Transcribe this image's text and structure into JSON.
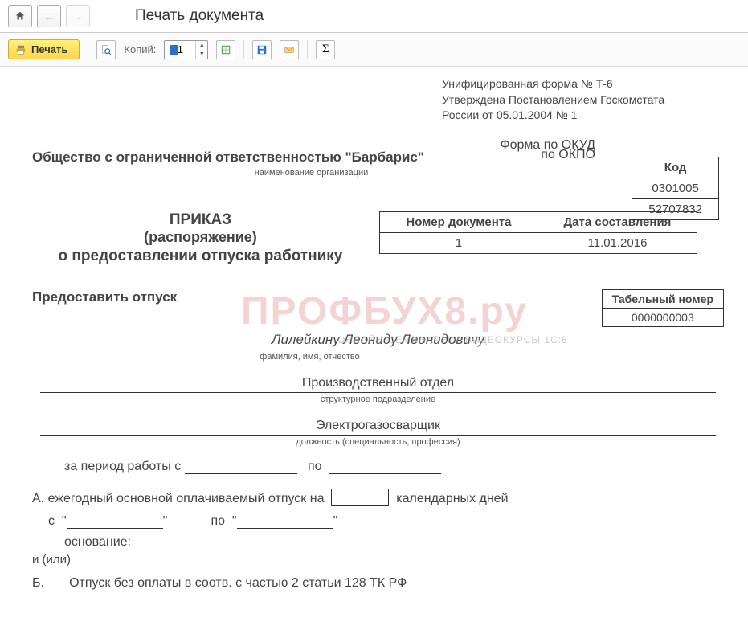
{
  "nav": {
    "title": "Печать документа"
  },
  "toolbar": {
    "print_label": "Печать",
    "copies_label": "Копий:",
    "copies_value": "1"
  },
  "form_header": {
    "line1": "Унифицированная форма № Т-6",
    "line2": "Утверждена Постановлением Госкомстата",
    "line3": "России от 05.01.2004 № 1"
  },
  "codes": {
    "header": "Код",
    "okud_label": "Форма по ОКУД",
    "okud_value": "0301005",
    "okpo_label": "по ОКПО",
    "okpo_value": "52707832"
  },
  "org": {
    "name": "Общество с ограниченной ответственностью \"Барбарис\"",
    "caption": "наименование организации"
  },
  "docnum": {
    "num_header": "Номер документа",
    "date_header": "Дата составления",
    "num_value": "1",
    "date_value": "11.01.2016"
  },
  "titles": {
    "t1": "ПРИКАЗ",
    "t2": "(распоряжение)",
    "t3": "о предоставлении отпуска работнику"
  },
  "grant": {
    "label": "Предоставить отпуск",
    "tabnum_header": "Табельный номер",
    "tabnum_value": "0000000003"
  },
  "employee": {
    "fio": "Лилейкину Леониду Леонидовичу",
    "fio_caption": "фамилия, имя, отчество",
    "dept": "Производственный отдел",
    "dept_caption": "структурное подразделение",
    "position": "Электрогазосварщик",
    "position_caption": "должность (специальность, профессия)"
  },
  "period": {
    "label_prefix": "за период работы с",
    "label_to": "по"
  },
  "sectionA": {
    "label": "А. ежегодный основной оплачиваемый отпуск на",
    "days_suffix": "календарных дней",
    "from_label": "с",
    "to_label": "по",
    "basis_label": "основание:",
    "or_label": "и (или)"
  },
  "sectionB": {
    "label": "Б.       Отпуск без оплаты в соотв. с частью 2 статьи 128 ТК РФ"
  },
  "watermark": {
    "main": "ПРОФБУХ8.ру",
    "sub": "ОНЛАЙН-СЕМИНАРЫ И ВИДЕОКУРСЫ 1С:8"
  }
}
